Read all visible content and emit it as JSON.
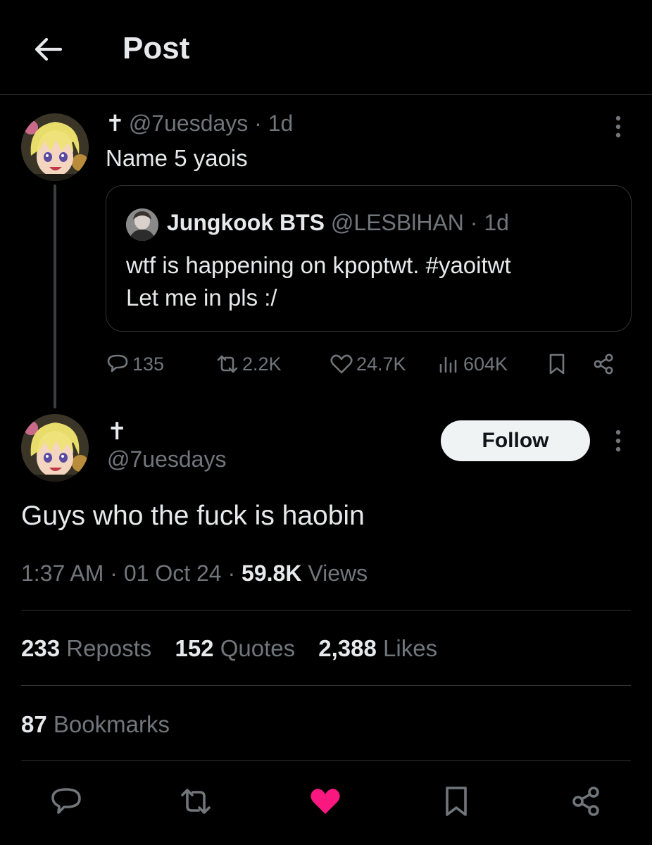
{
  "header": {
    "title": "Post",
    "back_icon": "arrow-left-icon"
  },
  "parent_post": {
    "cross": "✝",
    "handle": "@7uesdays",
    "time": "· 1d",
    "text": "Name 5 yaois",
    "quoted": {
      "name": "Jungkook BTS",
      "handle": "@LESBlHAN",
      "time": "· 1d",
      "text_line1": "wtf is happening on kpoptwt. #yaoitwt",
      "text_line2": "Let me in pls :/"
    },
    "actions": {
      "replies": "135",
      "reposts": "2.2K",
      "likes": "24.7K",
      "views": "604K"
    }
  },
  "main_post": {
    "cross": "✝",
    "handle": "@7uesdays",
    "follow_label": "Follow",
    "text": "Guys who the fuck is haobin",
    "time": "1:37 AM",
    "date": "01 Oct 24",
    "views_count": "59.8K",
    "views_label": "Views",
    "sep": "·",
    "reposts_count": "233",
    "reposts_label": "Reposts",
    "quotes_count": "152",
    "quotes_label": "Quotes",
    "likes_count": "2,388",
    "likes_label": "Likes",
    "bookmarks_count": "87",
    "bookmarks_label": "Bookmarks",
    "liked": true
  },
  "colors": {
    "background": "#000000",
    "text": "#e7e9ea",
    "muted": "#71767b",
    "border": "#2f3336",
    "like_active": "#f91880"
  }
}
